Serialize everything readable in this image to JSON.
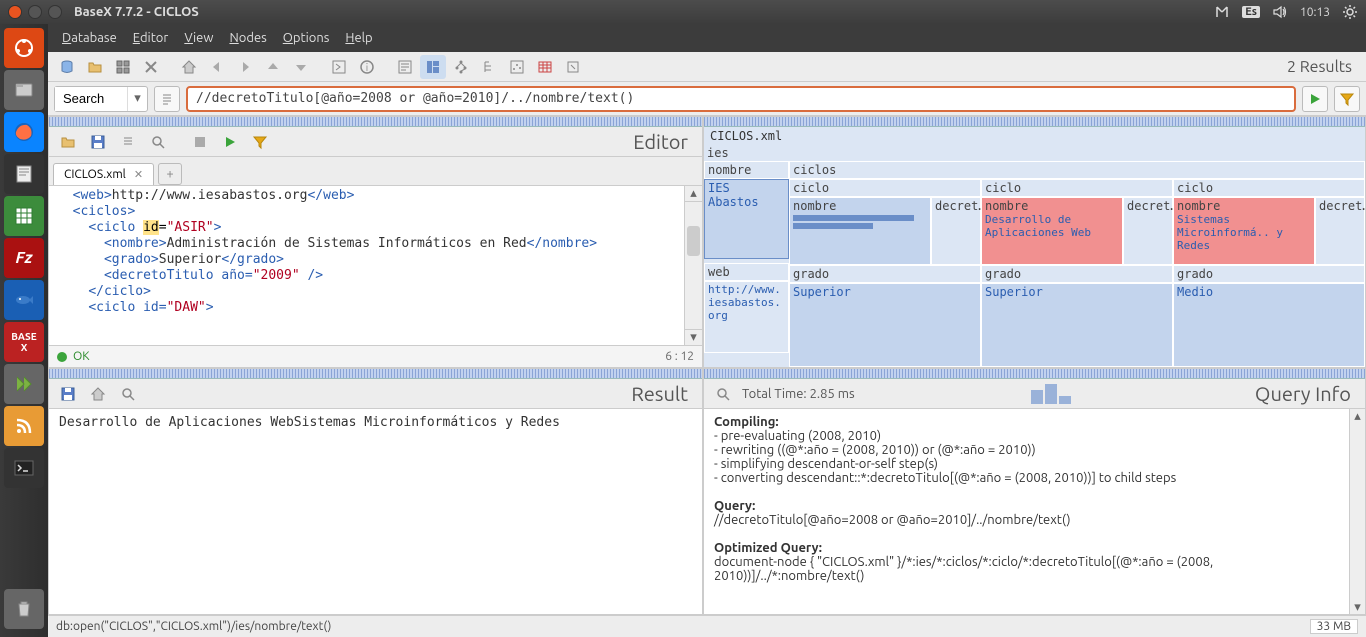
{
  "titlebar": {
    "title": "BaseX 7.7.2 - CICLOS",
    "lang": "Es",
    "time": "10:13"
  },
  "menubar": {
    "database": "Database",
    "editor": "Editor",
    "view": "View",
    "nodes": "Nodes",
    "options": "Options",
    "help": "Help"
  },
  "toolbar": {
    "results": "2 Results"
  },
  "queryrow": {
    "search_label": "Search",
    "query": "//decretoTitulo[@año=2008 or @año=2010]/../nombre/text()"
  },
  "editor": {
    "panel_title": "Editor",
    "tab_name": "CICLOS.xml",
    "status_ok": "OK",
    "cursor": "6 : 12",
    "code_html": "  <span class='tag'>&lt;web&gt;</span><span class='txt'>http://www.iesabastos.org</span><span class='tag'>&lt;/web&gt;</span>\n  <span class='tag'>&lt;ciclos&gt;</span>\n    <span class='tag'>&lt;ciclo </span><span class='attr'>id</span>=<span class='val'>\"ASIR\"</span><span class='tag'>&gt;</span>\n      <span class='tag'>&lt;nombre&gt;</span><span class='txt'>Administración de Sistemas Informáticos en Red</span><span class='tag'>&lt;/nombre&gt;</span>\n      <span class='tag'>&lt;grado&gt;</span><span class='txt'>Superior</span><span class='tag'>&lt;/grado&gt;</span>\n      <span class='tag'>&lt;decretoTitulo año=</span><span class='val'>\"2009\"</span><span class='tag'> /&gt;</span>\n    <span class='tag'>&lt;/ciclo&gt;</span>\n    <span class='tag'>&lt;ciclo id=</span><span class='val'>\"DAW\"</span><span class='tag'>&gt;</span>"
  },
  "vis": {
    "root": "CICLOS.xml",
    "ies": "ies",
    "nombre": "nombre",
    "ciclos": "ciclos",
    "ies_val": "IES Abastos",
    "web": "web",
    "web_val": "http://www.iesabastos.org",
    "ciclo": "ciclo",
    "decret": "decret…",
    "grado": "grado",
    "superior": "Superior",
    "medio": "Medio",
    "c2_name": "Desarrollo de Aplicaciones Web",
    "c3_name": "Sistemas Microinformá.. y Redes"
  },
  "result": {
    "panel_title": "Result",
    "text": "Desarrollo de Aplicaciones WebSistemas Microinformáticos y Redes"
  },
  "qi": {
    "panel_title": "Query Info",
    "total_time": "Total Time: 2.85 ms",
    "compiling": "Compiling:",
    "c1": "- pre-evaluating (2008, 2010)",
    "c2": "- rewriting ((@*:año = (2008, 2010)) or (@*:año = 2010))",
    "c3": "- simplifying descendant-or-self step(s)",
    "c4": "- converting descendant::*:decretoTitulo[(@*:año = (2008, 2010))] to child steps",
    "query_h": "Query:",
    "query_t": "//decretoTitulo[@año=2008 or @año=2010]/../nombre/text()",
    "opt_h": "Optimized Query:",
    "opt_t": "document-node { \"CICLOS.xml\" }/*:ies/*:ciclos/*:ciclo/*:decretoTitulo[(@*:año = (2008, 2010))]/../*:nombre/text()"
  },
  "statusbar": {
    "path": "db:open(\"CICLOS\",\"CICLOS.xml\")/ies/nombre/text()",
    "mem": "33 MB"
  }
}
